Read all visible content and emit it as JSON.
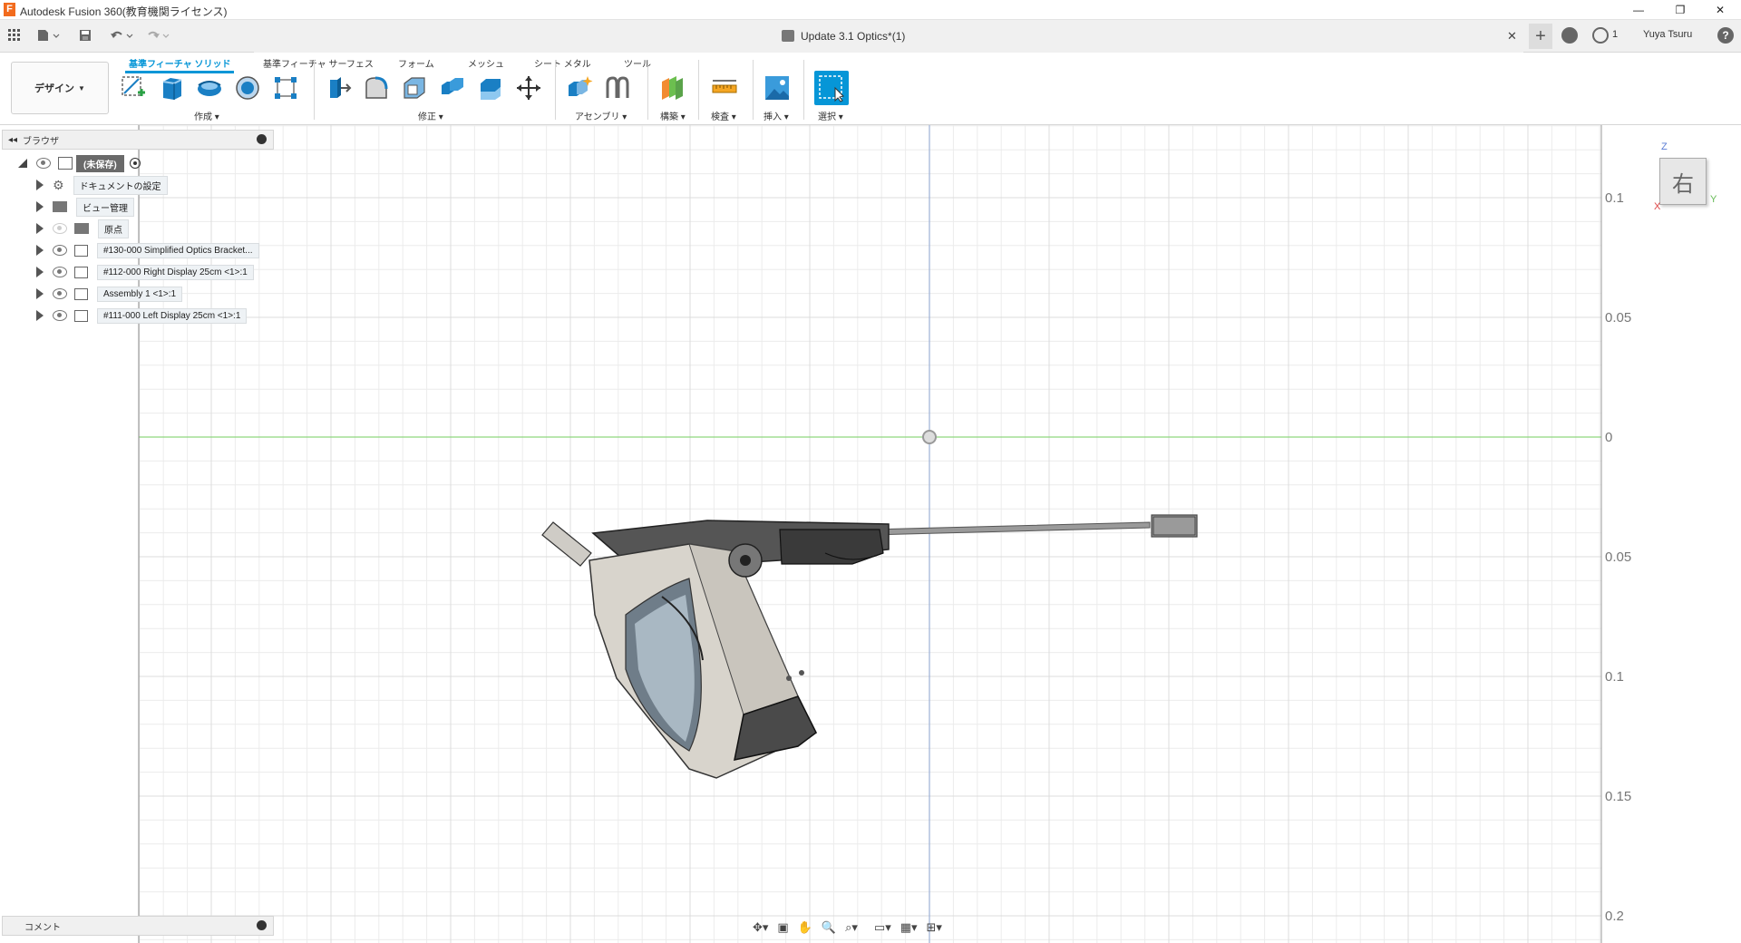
{
  "window": {
    "app_icon": "F",
    "title": "Autodesk Fusion 360(教育機関ライセンス)",
    "minimize": "—",
    "restore": "❐",
    "close": "✕"
  },
  "quick_access": {
    "grid_icon": "grid-icon",
    "file_icon": "file-icon",
    "save_icon": "save-icon",
    "undo_icon": "undo-icon",
    "redo_icon": "redo-icon"
  },
  "doc_tab": {
    "title": "Update 3.1 Optics*(1)",
    "close": "✕",
    "add": "+"
  },
  "account": {
    "job_count": "1",
    "user_name": "Yuya Tsuru",
    "help": "?"
  },
  "workspace": {
    "label": "デザイン"
  },
  "ribbon_tabs": [
    {
      "label": "基準フィーチャ ソリッド",
      "active": true
    },
    {
      "label": "基準フィーチャ サーフェス",
      "active": false
    },
    {
      "label": "フォーム",
      "active": false
    },
    {
      "label": "メッシュ",
      "active": false
    },
    {
      "label": "シート メタル",
      "active": false
    },
    {
      "label": "ツール",
      "active": false
    }
  ],
  "ribbon_groups": {
    "create": "作成",
    "modify": "修正",
    "assemble": "アセンブリ",
    "construct": "構築",
    "inspect": "検査",
    "insert": "挿入",
    "select": "選択"
  },
  "browser": {
    "title": "ブラウザ",
    "root": "(未保存)",
    "items": [
      {
        "label": "ドキュメントの設定",
        "icon": "gear-icon"
      },
      {
        "label": "ビュー管理",
        "icon": "folder-icon"
      },
      {
        "label": "原点",
        "icon": "folder-icon"
      },
      {
        "label": "#130-000 Simplified Optics Bracket...",
        "icon": "component-icon"
      },
      {
        "label": "#112-000 Right Display 25cm <1>:1",
        "icon": "component-icon"
      },
      {
        "label": "Assembly 1 <1>:1",
        "icon": "component-icon"
      },
      {
        "label": "#111-000 Left Display 25cm <1>:1",
        "icon": "component-icon"
      }
    ]
  },
  "comment_panel": {
    "title": "コメント"
  },
  "viewcube": {
    "face": "右",
    "axis_z": "Z",
    "axis_y": "Y",
    "axis_x": "X"
  },
  "ruler": {
    "labels": [
      "0.1",
      "0.05",
      "0",
      "0.05",
      "0.1",
      "0.15",
      "0.2"
    ]
  },
  "colors": {
    "accent": "#0696d7",
    "grid": "#e6e6e6",
    "green_axis": "#7fd46f",
    "blue_axis": "#8ba3c9"
  }
}
